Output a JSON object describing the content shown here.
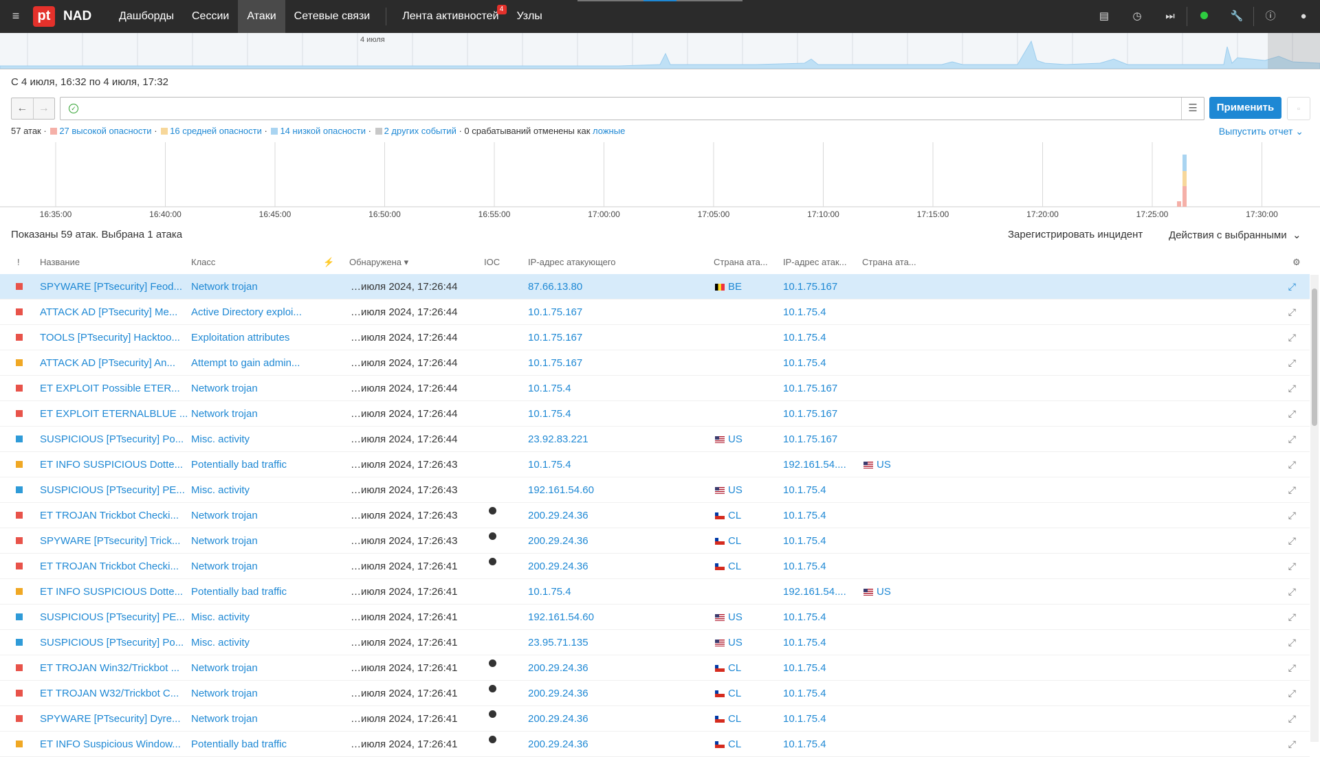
{
  "app": {
    "logo": "pt",
    "brand": "NAD"
  },
  "nav": [
    {
      "label": "Дашборды",
      "active": false
    },
    {
      "label": "Сессии",
      "active": false
    },
    {
      "label": "Атаки",
      "active": true
    },
    {
      "label": "Сетевые связи",
      "active": false
    },
    {
      "label": "Лента активностей",
      "active": false,
      "badge": "4"
    },
    {
      "label": "Узлы",
      "active": false
    }
  ],
  "timeline": {
    "label": "4 июля"
  },
  "range": "С 4 июля, 16:32 по 4 июля, 17:32",
  "filter": {
    "apply": "Применить"
  },
  "summary": {
    "total": "57 атак",
    "high": "27 высокой опасности",
    "medium": "16 средней опасности",
    "low": "14 низкой опасности",
    "other": "2 других событий",
    "cancelled": "0 срабатываний отменены как",
    "false_link": "ложные",
    "report": "Выпустить отчет"
  },
  "histogram": {
    "ticks": [
      "16:35:00",
      "16:40:00",
      "16:45:00",
      "16:50:00",
      "16:55:00",
      "17:00:00",
      "17:05:00",
      "17:10:00",
      "17:15:00",
      "17:20:00",
      "17:25:00",
      "17:30:00"
    ]
  },
  "list": {
    "shown": "Показаны 59 атак.  Выбрана 1 атака",
    "register": "Зарегистрировать инцидент",
    "actions": "Действия с выбранными"
  },
  "columns": {
    "sev": "!",
    "name": "Название",
    "class": "Класс",
    "detected": "Обнаружена",
    "ioc": "IOC",
    "src_ip": "IP-адрес атакующего",
    "src_country": "Страна ата...",
    "dst_ip": "IP-адрес атак...",
    "dst_country": "Страна ата..."
  },
  "colors": {
    "high": "#e8534a",
    "medium": "#f0a824",
    "low": "#2f9bd8",
    "accent": "#1e88d4"
  },
  "rows": [
    {
      "sev": "high",
      "name": "SPYWARE [PTsecurity] Feod...",
      "class": "Network trojan",
      "time": "…июля 2024, 17:26:44",
      "ioc": false,
      "src": "87.66.13.80",
      "src_cc": "BE",
      "dst": "10.1.75.167",
      "dst_cc": "",
      "selected": true
    },
    {
      "sev": "high",
      "name": "ATTACK AD [PTsecurity] Me...",
      "class": "Active Directory exploi...",
      "time": "…июля 2024, 17:26:44",
      "ioc": false,
      "src": "10.1.75.167",
      "src_cc": "",
      "dst": "10.1.75.4",
      "dst_cc": ""
    },
    {
      "sev": "high",
      "name": "TOOLS [PTsecurity] Hacktoo...",
      "class": "Exploitation attributes",
      "time": "…июля 2024, 17:26:44",
      "ioc": false,
      "src": "10.1.75.167",
      "src_cc": "",
      "dst": "10.1.75.4",
      "dst_cc": ""
    },
    {
      "sev": "medium",
      "name": "ATTACK AD [PTsecurity] An...",
      "class": "Attempt to gain admin...",
      "time": "…июля 2024, 17:26:44",
      "ioc": false,
      "src": "10.1.75.167",
      "src_cc": "",
      "dst": "10.1.75.4",
      "dst_cc": ""
    },
    {
      "sev": "high",
      "name": "ET EXPLOIT Possible ETER...",
      "class": "Network trojan",
      "time": "…июля 2024, 17:26:44",
      "ioc": false,
      "src": "10.1.75.4",
      "src_cc": "",
      "dst": "10.1.75.167",
      "dst_cc": ""
    },
    {
      "sev": "high",
      "name": "ET EXPLOIT ETERNALBLUE ...",
      "class": "Network trojan",
      "time": "…июля 2024, 17:26:44",
      "ioc": false,
      "src": "10.1.75.4",
      "src_cc": "",
      "dst": "10.1.75.167",
      "dst_cc": ""
    },
    {
      "sev": "low",
      "name": "SUSPICIOUS [PTsecurity] Po...",
      "class": "Misc. activity",
      "time": "…июля 2024, 17:26:44",
      "ioc": false,
      "src": "23.92.83.221",
      "src_cc": "US",
      "dst": "10.1.75.167",
      "dst_cc": ""
    },
    {
      "sev": "medium",
      "name": "ET INFO SUSPICIOUS Dotte...",
      "class": "Potentially bad traffic",
      "time": "…июля 2024, 17:26:43",
      "ioc": false,
      "src": "10.1.75.4",
      "src_cc": "",
      "dst": "192.161.54....",
      "dst_cc": "US"
    },
    {
      "sev": "low",
      "name": "SUSPICIOUS [PTsecurity] PE...",
      "class": "Misc. activity",
      "time": "…июля 2024, 17:26:43",
      "ioc": false,
      "src": "192.161.54.60",
      "src_cc": "US",
      "dst": "10.1.75.4",
      "dst_cc": ""
    },
    {
      "sev": "high",
      "name": "ET TROJAN Trickbot Checki...",
      "class": "Network trojan",
      "time": "…июля 2024, 17:26:43",
      "ioc": true,
      "src": "200.29.24.36",
      "src_cc": "CL",
      "dst": "10.1.75.4",
      "dst_cc": ""
    },
    {
      "sev": "high",
      "name": "SPYWARE [PTsecurity] Trick...",
      "class": "Network trojan",
      "time": "…июля 2024, 17:26:43",
      "ioc": true,
      "src": "200.29.24.36",
      "src_cc": "CL",
      "dst": "10.1.75.4",
      "dst_cc": ""
    },
    {
      "sev": "high",
      "name": "ET TROJAN Trickbot Checki...",
      "class": "Network trojan",
      "time": "…июля 2024, 17:26:41",
      "ioc": true,
      "src": "200.29.24.36",
      "src_cc": "CL",
      "dst": "10.1.75.4",
      "dst_cc": ""
    },
    {
      "sev": "medium",
      "name": "ET INFO SUSPICIOUS Dotte...",
      "class": "Potentially bad traffic",
      "time": "…июля 2024, 17:26:41",
      "ioc": false,
      "src": "10.1.75.4",
      "src_cc": "",
      "dst": "192.161.54....",
      "dst_cc": "US"
    },
    {
      "sev": "low",
      "name": "SUSPICIOUS [PTsecurity] PE...",
      "class": "Misc. activity",
      "time": "…июля 2024, 17:26:41",
      "ioc": false,
      "src": "192.161.54.60",
      "src_cc": "US",
      "dst": "10.1.75.4",
      "dst_cc": ""
    },
    {
      "sev": "low",
      "name": "SUSPICIOUS [PTsecurity] Po...",
      "class": "Misc. activity",
      "time": "…июля 2024, 17:26:41",
      "ioc": false,
      "src": "23.95.71.135",
      "src_cc": "US",
      "dst": "10.1.75.4",
      "dst_cc": ""
    },
    {
      "sev": "high",
      "name": "ET TROJAN Win32/Trickbot ...",
      "class": "Network trojan",
      "time": "…июля 2024, 17:26:41",
      "ioc": true,
      "src": "200.29.24.36",
      "src_cc": "CL",
      "dst": "10.1.75.4",
      "dst_cc": ""
    },
    {
      "sev": "high",
      "name": "ET TROJAN W32/Trickbot C...",
      "class": "Network trojan",
      "time": "…июля 2024, 17:26:41",
      "ioc": true,
      "src": "200.29.24.36",
      "src_cc": "CL",
      "dst": "10.1.75.4",
      "dst_cc": ""
    },
    {
      "sev": "high",
      "name": "SPYWARE [PTsecurity] Dyre...",
      "class": "Network trojan",
      "time": "…июля 2024, 17:26:41",
      "ioc": true,
      "src": "200.29.24.36",
      "src_cc": "CL",
      "dst": "10.1.75.4",
      "dst_cc": ""
    },
    {
      "sev": "medium",
      "name": "ET INFO Suspicious Window...",
      "class": "Potentially bad traffic",
      "time": "…июля 2024, 17:26:41",
      "ioc": true,
      "src": "200.29.24.36",
      "src_cc": "CL",
      "dst": "10.1.75.4",
      "dst_cc": ""
    }
  ]
}
